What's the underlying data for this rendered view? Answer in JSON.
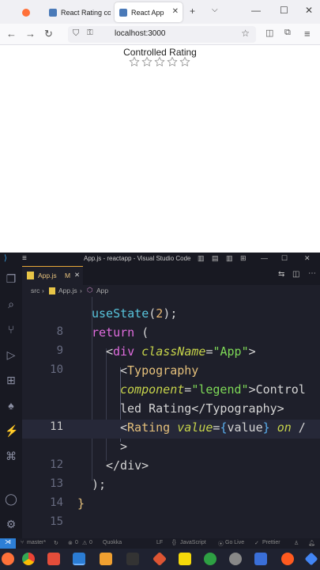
{
  "browser": {
    "tabs": [
      {
        "label": "",
        "icon": "firefox-icon"
      },
      {
        "label": "React Rating con",
        "icon": "react-icon"
      },
      {
        "label": "React App",
        "icon": "react-icon"
      }
    ],
    "new_tab_label": "+",
    "url": "localhost:3000"
  },
  "page": {
    "title": "Controlled Rating",
    "rating_value": 0,
    "max_stars": 5
  },
  "vscode": {
    "title": "App.js - reactapp - Visual Studio Code",
    "tab_label": "App.js",
    "tab_modified": "M",
    "breadcrumb": {
      "folder": "src",
      "file": "App.js",
      "symbol": "App"
    },
    "status": {
      "branch": "master*",
      "errors": "0",
      "warnings": "0",
      "quokka": "Quokka",
      "eol": "LF",
      "language": "JavaScript",
      "golive": "Go Live",
      "prettier": "Prettier"
    }
  },
  "code": {
    "line_numbers": [
      "8",
      "9",
      "10",
      "11",
      "12",
      "13",
      "14",
      "15"
    ],
    "t_usestate": "useState",
    "t_paren_open": "(",
    "t_two": "2",
    "t_paren_close_semi": ");",
    "t_return": "return",
    "t_return_paren": " (",
    "t_lt": "<",
    "t_div": "div",
    "t_classname": "className",
    "t_eq": "=",
    "t_app_str": "\"App\"",
    "t_gt": ">",
    "t_typography": "Typography",
    "t_component": "component",
    "t_legend_str": "\"legend\"",
    "t_controlled_1": ">Control",
    "t_controlled_2": "led Rating</Typography>",
    "t_rating": "Rating",
    "t_value_attr": "value",
    "t_brace_open": "{",
    "t_value_var": "value",
    "t_brace_close": "}",
    "t_on": "on",
    "t_slash": " /",
    "t_close_div": "</div>",
    "t_paren_semi": ");",
    "t_brace_end": "}"
  },
  "colors": {
    "accent": "#007acc",
    "keyword": "#e06cde",
    "function": "#58c4dc",
    "tag": "#e5c07b",
    "attribute": "#c6d34a",
    "string": "#7ed957"
  }
}
